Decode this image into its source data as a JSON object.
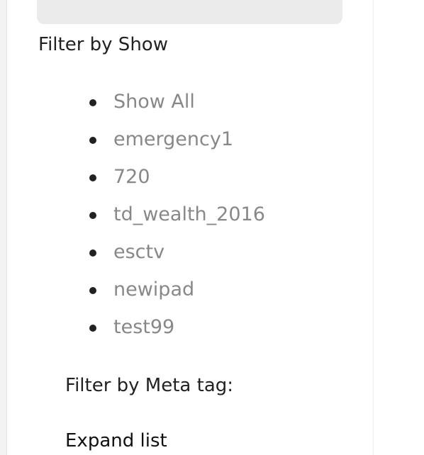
{
  "filters": {
    "show_heading": "Filter by Show",
    "show_items": [
      {
        "label": "Show All"
      },
      {
        "label": "emergency1"
      },
      {
        "label": "720"
      },
      {
        "label": "td_wealth_2016"
      },
      {
        "label": "esctv"
      },
      {
        "label": "newipad"
      },
      {
        "label": "test99"
      }
    ],
    "meta_heading": "Filter by Meta tag:",
    "expand_label": "Expand list"
  },
  "colors": {
    "heading": "#222222",
    "link_gray": "#888888",
    "bullet": "#222222",
    "search_bg": "#ebebeb"
  }
}
